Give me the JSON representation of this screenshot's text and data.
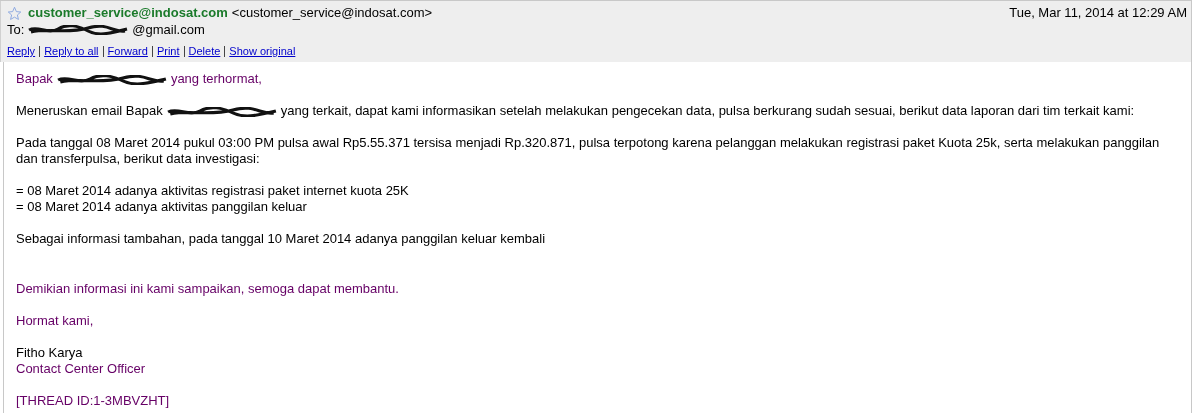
{
  "header": {
    "starred": false,
    "sender_name": "customer_service@indosat.com",
    "sender_address": "<customer_service@indosat.com>",
    "date": "Tue, Mar 11, 2014 at 12:29 AM",
    "to_label": "To:",
    "to_parts": [
      {
        "kind": "redaction"
      },
      {
        "kind": "text",
        "text": "@gmail.com"
      }
    ]
  },
  "actions": [
    "Reply",
    "Reply to all",
    "Forward",
    "Print",
    "Delete",
    "Show original"
  ],
  "paragraphs": [
    {
      "kind": "normal",
      "lines": [
        {
          "color": "#660066",
          "parts": [
            {
              "kind": "text",
              "text": "Bapak"
            },
            {
              "kind": "redaction"
            },
            {
              "kind": "text",
              "text": "yang terhormat,"
            }
          ]
        }
      ]
    },
    {
      "kind": "normal",
      "lines": [
        {
          "color": "#000000",
          "parts": [
            {
              "kind": "text",
              "text": "Meneruskan email Bapak"
            },
            {
              "kind": "redaction"
            },
            {
              "kind": "text",
              "text": "yang terkait, dapat kami informasikan setelah melakukan pengecekan data, pulsa berkurang sudah sesuai, berikut data laporan dari tim terkait kami:"
            }
          ]
        }
      ]
    },
    {
      "kind": "normal",
      "lines": [
        {
          "color": "#000000",
          "parts": [
            {
              "kind": "text",
              "text": "Pada tanggal 08 Maret 2014 pukul 03:00 PM pulsa awal Rp5.55.371 tersisa menjadi Rp.320.871, pulsa terpotong karena pelanggan melakukan registrasi paket Kuota 25k, serta melakukan panggilan dan transferpulsa, berikut data investigasi:"
            }
          ]
        }
      ]
    },
    {
      "kind": "normal",
      "lines": [
        {
          "color": "#000000",
          "parts": [
            {
              "kind": "text",
              "text": "= 08 Maret 2014 adanya aktivitas registrasi paket internet kuota 25K"
            }
          ]
        },
        {
          "color": "#000000",
          "parts": [
            {
              "kind": "text",
              "text": "= 08 Maret 2014 adanya aktivitas panggilan keluar"
            }
          ]
        }
      ]
    },
    {
      "kind": "normal",
      "lines": [
        {
          "color": "#000000",
          "parts": [
            {
              "kind": "text",
              "text": "Sebagai informasi tambahan, pada tanggal 10 Maret 2014 adanya panggilan keluar kembali"
            }
          ]
        }
      ]
    },
    {
      "kind": "spaced",
      "lines": [
        {
          "color": "#660066",
          "parts": [
            {
              "kind": "text",
              "text": "Demikian informasi ini kami sampaikan, semoga dapat membantu."
            }
          ]
        }
      ]
    },
    {
      "kind": "normal",
      "lines": [
        {
          "color": "#660066",
          "parts": [
            {
              "kind": "text",
              "text": "Hormat kami,"
            }
          ]
        }
      ]
    },
    {
      "kind": "normal",
      "lines": [
        {
          "color": "#000000",
          "parts": [
            {
              "kind": "text",
              "text": "Fitho Karya"
            }
          ]
        },
        {
          "color": "#660066",
          "parts": [
            {
              "kind": "text",
              "text": "Contact Center Officer"
            }
          ]
        }
      ]
    },
    {
      "kind": "normal",
      "lines": [
        {
          "color": "#660066",
          "parts": [
            {
              "kind": "text",
              "text": "[THREAD ID:1-3MBVZHT]"
            }
          ]
        }
      ]
    }
  ]
}
